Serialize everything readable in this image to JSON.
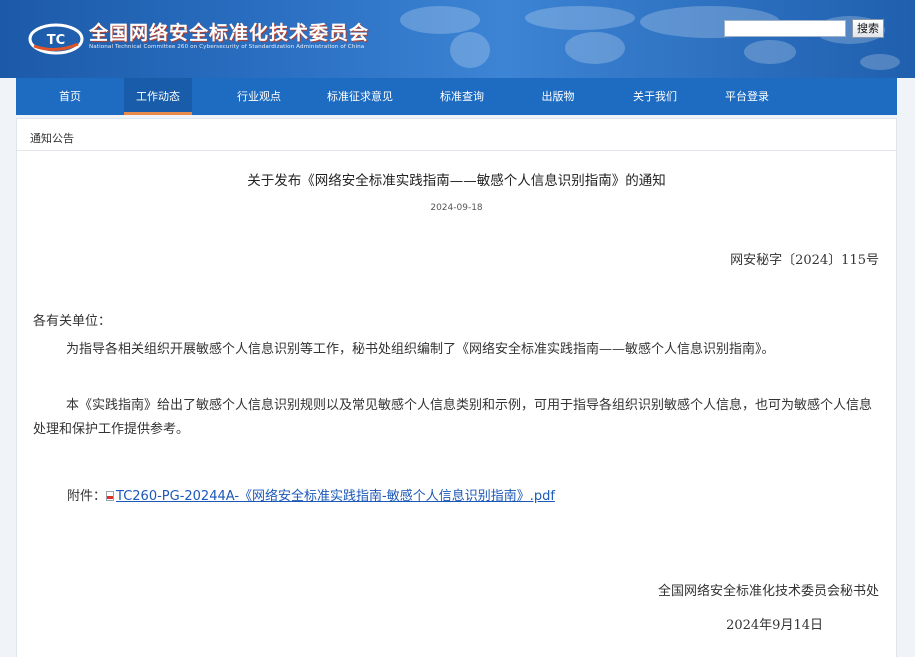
{
  "header": {
    "title": "全国网络安全标准化技术委员会",
    "subtitle": "National Technical Committee 260 on Cybersecurity of Standardization Administration of China",
    "logo_text": "TC",
    "search": {
      "value": "",
      "button_label": "搜索"
    }
  },
  "nav": {
    "items": [
      {
        "label": "首页"
      },
      {
        "label": "工作动态"
      },
      {
        "label": "行业观点"
      },
      {
        "label": "标准征求意见"
      },
      {
        "label": "标准查询"
      },
      {
        "label": "出版物"
      },
      {
        "label": "关于我们"
      },
      {
        "label": "平台登录"
      }
    ],
    "active_label": "工作动态"
  },
  "breadcrumb": "通知公告",
  "article": {
    "title": "关于发布《网络安全标准实践指南——敏感个人信息识别指南》的通知",
    "date": "2024-09-18",
    "doc_number": "网安秘字〔2024〕115号",
    "salutation": "各有关单位：",
    "paragraphs": [
      "为指导各相关组织开展敏感个人信息识别等工作，秘书处组织编制了《网络安全标准实践指南——敏感个人信息识别指南》。",
      "本《实践指南》给出了敏感个人信息识别规则以及常见敏感个人信息类别和示例，可用于指导各组织识别敏感个人信息，也可为敏感个人信息处理和保护工作提供参考。"
    ],
    "attachment_label": "附件：",
    "attachment_link": "TC260-PG-20244A-《网络安全标准实践指南-敏感个人信息识别指南》.pdf",
    "signature": "全国网络安全标准化技术委员会秘书处",
    "sign_date": "2024年9月14日"
  },
  "colors": {
    "nav_bg": "#1e6cc2",
    "nav_active_underline": "#e88a4b",
    "link": "#1b58b8",
    "title_shadow": "#c03a1c"
  }
}
